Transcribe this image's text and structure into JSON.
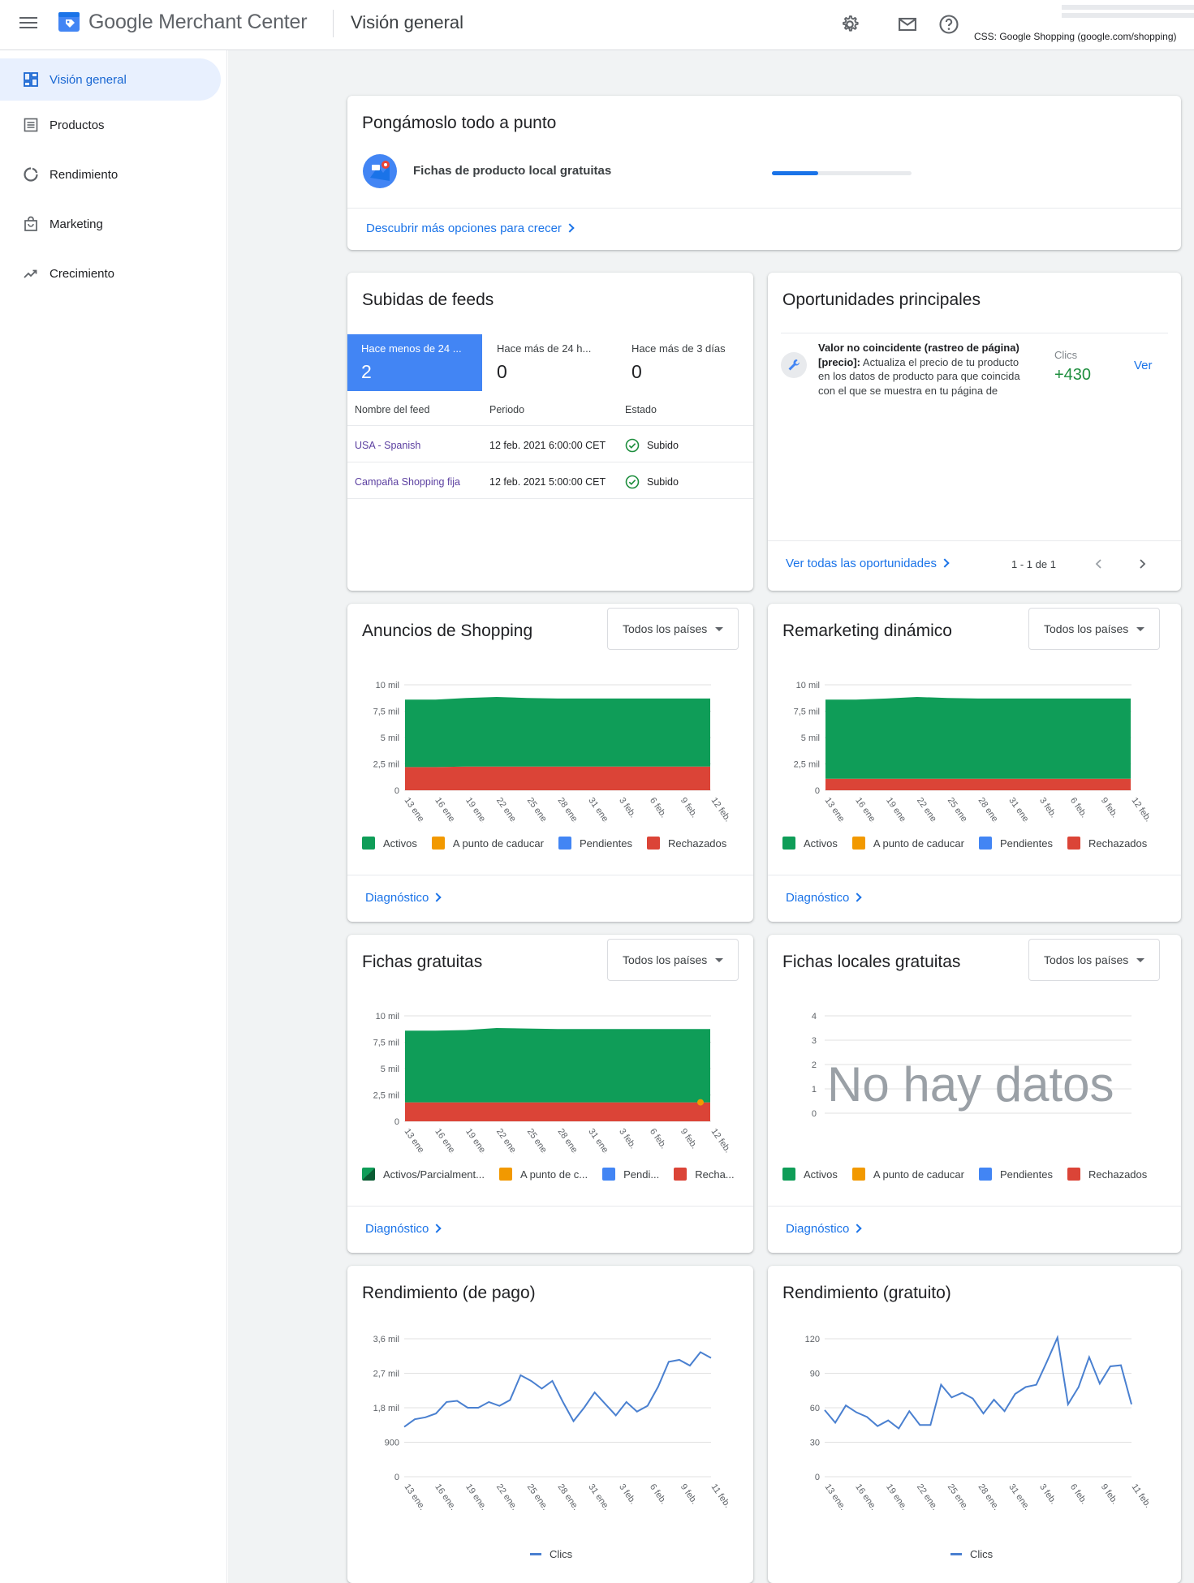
{
  "header": {
    "product_name": "Google Merchant Center",
    "page_title": "Visión general",
    "css_label": "CSS: Google Shopping (google.com/shopping)"
  },
  "sidebar": {
    "items": [
      {
        "label": "Visión general",
        "icon": "dashboard-icon",
        "active": true
      },
      {
        "label": "Productos",
        "icon": "list-icon"
      },
      {
        "label": "Rendimiento",
        "icon": "donut-icon"
      },
      {
        "label": "Marketing",
        "icon": "shopping-bag-icon"
      },
      {
        "label": "Crecimiento",
        "icon": "trending-up-icon"
      }
    ]
  },
  "setup": {
    "title": "Pongámoslo todo a punto",
    "task_label": "Fichas de producto local gratuitas",
    "progress": 0.33,
    "link": "Descubrir más opciones para crecer"
  },
  "feeds": {
    "title": "Subidas de feeds",
    "tabs": [
      {
        "label": "Hace menos de 24 ...",
        "value": "2"
      },
      {
        "label": "Hace más de 24 h...",
        "value": "0"
      },
      {
        "label": "Hace más de 3 días",
        "value": "0"
      }
    ],
    "columns": [
      "Nombre del feed",
      "Periodo",
      "Estado"
    ],
    "rows": [
      {
        "name": "USA - Spanish",
        "period": "12 feb. 2021 6:00:00 CET",
        "status": "Subido"
      },
      {
        "name": "Campaña Shopping fija",
        "period": "12 feb. 2021 5:00:00 CET",
        "status": "Subido"
      }
    ]
  },
  "opportunities": {
    "title": "Oportunidades principales",
    "item_title": "Valor no coincidente (rastreo de página)",
    "item_tag": "[precio]:",
    "item_desc_1": " Actualiza el precio de tu producto",
    "item_desc_2": "en los datos de producto para que coincida",
    "item_desc_3": "con el que se muestra en tu página de",
    "metric_label": "Clics",
    "metric_value": "+430",
    "view_label": "Ver",
    "all_link": "Ver todas las oportunidades",
    "pagination": "1 - 1 de 1"
  },
  "common": {
    "country_filter": "Todos los países",
    "diagnostic_link": "Diagnóstico",
    "x_ticks": [
      "13 ene.",
      "16 ene.",
      "19 ene.",
      "22 ene.",
      "25 ene.",
      "28 ene.",
      "31 ene.",
      "3 feb.",
      "6 feb.",
      "9 feb.",
      "12 feb."
    ],
    "y_ticks_items": [
      "0",
      "2,5 mil",
      "5 mil",
      "7,5 mil",
      "10 mil"
    ]
  },
  "colors": {
    "activos": "#0f9d58",
    "a_punto": "#f29900",
    "pendientes": "#4285f4",
    "rechazados": "#db4437",
    "line": "#4a80d0"
  },
  "shopping_ads": {
    "title": "Anuncios de Shopping",
    "legend": [
      "Activos",
      "A punto de caducar",
      "Pendientes",
      "Rechazados"
    ]
  },
  "remarketing": {
    "title": "Remarketing dinámico",
    "legend": [
      "Activos",
      "A punto de caducar",
      "Pendientes",
      "Rechazados"
    ]
  },
  "free_listings": {
    "title": "Fichas gratuitas",
    "legend": [
      "Activos/Parcialment...",
      "A punto de c...",
      "Pendi...",
      "Recha..."
    ]
  },
  "local_listings": {
    "title": "Fichas locales gratuitas",
    "no_data": "No hay datos",
    "y_ticks": [
      "0",
      "1",
      "2",
      "3",
      "4"
    ],
    "legend": [
      "Activos",
      "A punto de caducar",
      "Pendientes",
      "Rechazados"
    ]
  },
  "perf_paid": {
    "title": "Rendimiento (de pago)",
    "y_ticks": [
      "0",
      "900",
      "1,8 mil",
      "2,7 mil",
      "3,6 mil"
    ],
    "x_ticks": [
      "13 ene.",
      "16 ene.",
      "19 ene.",
      "22 ene.",
      "25 ene.",
      "28 ene.",
      "31 ene.",
      "3 feb.",
      "6 feb.",
      "9 feb.",
      "11 feb."
    ],
    "legend": "Clics"
  },
  "perf_free": {
    "title": "Rendimiento (gratuito)",
    "y_ticks": [
      "0",
      "30",
      "60",
      "90",
      "120"
    ],
    "x_ticks": [
      "13 ene.",
      "16 ene.",
      "19 ene.",
      "22 ene.",
      "25 ene.",
      "28 ene.",
      "31 ene.",
      "3 feb.",
      "6 feb.",
      "9 feb.",
      "11 feb."
    ],
    "legend": "Clics"
  },
  "chart_data": [
    {
      "type": "area",
      "title": "Anuncios de Shopping",
      "x": [
        "13 ene.",
        "16 ene.",
        "19 ene.",
        "22 ene.",
        "25 ene.",
        "28 ene.",
        "31 ene.",
        "3 feb.",
        "6 feb.",
        "9 feb.",
        "12 feb."
      ],
      "ylim": [
        0,
        10000
      ],
      "series": [
        {
          "name": "Rechazados",
          "values": [
            2200,
            2200,
            2250,
            2250,
            2250,
            2250,
            2250,
            2250,
            2250,
            2250,
            2250
          ]
        },
        {
          "name": "Activos",
          "values": [
            6400,
            6400,
            6500,
            6600,
            6500,
            6450,
            6450,
            6450,
            6450,
            6450,
            6450
          ]
        }
      ],
      "stacked": true,
      "legend": [
        "Activos",
        "A punto de caducar",
        "Pendientes",
        "Rechazados"
      ]
    },
    {
      "type": "area",
      "title": "Remarketing dinámico",
      "x": [
        "13 ene.",
        "16 ene.",
        "19 ene.",
        "22 ene.",
        "25 ene.",
        "28 ene.",
        "31 ene.",
        "3 feb.",
        "6 feb.",
        "9 feb.",
        "12 feb."
      ],
      "ylim": [
        0,
        10000
      ],
      "series": [
        {
          "name": "Rechazados",
          "values": [
            1100,
            1100,
            1100,
            1100,
            1100,
            1100,
            1100,
            1100,
            1100,
            1100,
            1100
          ]
        },
        {
          "name": "Activos",
          "values": [
            7500,
            7500,
            7600,
            7750,
            7650,
            7600,
            7600,
            7600,
            7600,
            7600,
            7600
          ]
        }
      ],
      "stacked": true,
      "legend": [
        "Activos",
        "A punto de caducar",
        "Pendientes",
        "Rechazados"
      ]
    },
    {
      "type": "area",
      "title": "Fichas gratuitas",
      "x": [
        "13 ene.",
        "16 ene.",
        "19 ene.",
        "22 ene.",
        "25 ene.",
        "28 ene.",
        "31 ene.",
        "3 feb.",
        "6 feb.",
        "9 feb.",
        "12 feb."
      ],
      "ylim": [
        0,
        10000
      ],
      "series": [
        {
          "name": "Rechazados",
          "values": [
            1800,
            1800,
            1800,
            1800,
            1800,
            1800,
            1800,
            1800,
            1800,
            1800,
            1800
          ]
        },
        {
          "name": "Activos",
          "values": [
            6800,
            6800,
            6850,
            7050,
            7000,
            6950,
            6950,
            6950,
            6950,
            6950,
            6950
          ]
        }
      ],
      "stacked": true,
      "legend": [
        "Activos/Parcialment...",
        "A punto de c...",
        "Pendi...",
        "Recha..."
      ]
    },
    {
      "type": "line",
      "title": "Rendimiento (de pago)",
      "ylim": [
        0,
        3600
      ],
      "x": [
        "13 ene.",
        "14 ene.",
        "15 ene.",
        "16 ene.",
        "17 ene.",
        "18 ene.",
        "19 ene.",
        "20 ene.",
        "21 ene.",
        "22 ene.",
        "23 ene.",
        "24 ene.",
        "25 ene.",
        "26 ene.",
        "27 ene.",
        "28 ene.",
        "29 ene.",
        "30 ene.",
        "31 ene.",
        "1 feb.",
        "2 feb.",
        "3 feb.",
        "4 feb.",
        "5 feb.",
        "6 feb.",
        "7 feb.",
        "8 feb.",
        "9 feb.",
        "10 feb.",
        "11 feb."
      ],
      "series": [
        {
          "name": "Clics",
          "values": [
            1300,
            1500,
            1550,
            1650,
            1950,
            1980,
            1800,
            1800,
            1950,
            1850,
            2000,
            2650,
            2500,
            2300,
            2500,
            1950,
            1450,
            1800,
            2200,
            1900,
            1600,
            1950,
            1700,
            1850,
            2350,
            3000,
            3050,
            2900,
            3250,
            3100
          ]
        }
      ],
      "legend": [
        "Clics"
      ]
    },
    {
      "type": "line",
      "title": "Rendimiento (gratuito)",
      "ylim": [
        0,
        120
      ],
      "x": [
        "13 ene.",
        "14 ene.",
        "15 ene.",
        "16 ene.",
        "17 ene.",
        "18 ene.",
        "19 ene.",
        "20 ene.",
        "21 ene.",
        "22 ene.",
        "23 ene.",
        "24 ene.",
        "25 ene.",
        "26 ene.",
        "27 ene.",
        "28 ene.",
        "29 ene.",
        "30 ene.",
        "31 ene.",
        "1 feb.",
        "2 feb.",
        "3 feb.",
        "4 feb.",
        "5 feb.",
        "6 feb.",
        "7 feb.",
        "8 feb.",
        "9 feb.",
        "10 feb.",
        "11 feb."
      ],
      "series": [
        {
          "name": "Clics",
          "values": [
            58,
            47,
            62,
            56,
            52,
            44,
            49,
            42,
            57,
            45,
            45,
            80,
            69,
            73,
            68,
            55,
            67,
            57,
            72,
            78,
            80,
            100,
            121,
            63,
            78,
            104,
            81,
            96,
            97,
            63
          ]
        }
      ],
      "legend": [
        "Clics"
      ]
    }
  ]
}
